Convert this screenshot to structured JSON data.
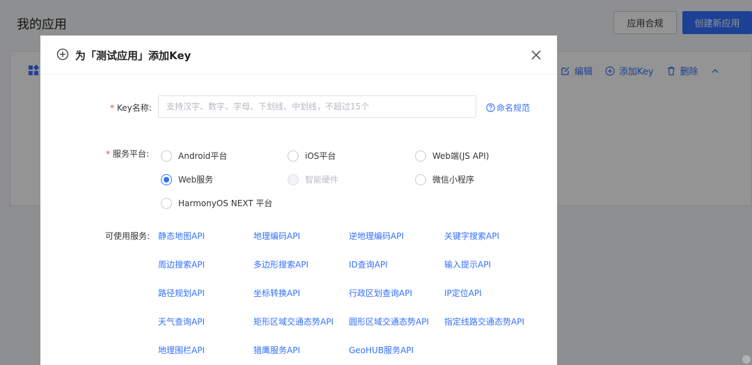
{
  "page": {
    "title": "我的应用",
    "compliance_button": "应用合规",
    "create_button": "创建新应用",
    "card_actions": {
      "edit": "编辑",
      "add_key": "添加Key",
      "delete": "删除"
    }
  },
  "modal": {
    "title": "为「测试应用」添加Key",
    "key_name": {
      "label": "Key名称:",
      "placeholder": "支持汉字、数字、字母、下划线、中划线，不超过15个",
      "value": "",
      "naming_rule_link": "命名规范"
    },
    "platform": {
      "label": "服务平台:",
      "selected": "Web服务",
      "options": [
        {
          "label": "Android平台",
          "state": "unchecked"
        },
        {
          "label": "iOS平台",
          "state": "unchecked"
        },
        {
          "label": "Web端(JS API)",
          "state": "unchecked"
        },
        {
          "label": "Web服务",
          "state": "checked"
        },
        {
          "label": "智能硬件",
          "state": "disabled"
        },
        {
          "label": "微信小程序",
          "state": "unchecked"
        },
        {
          "label": "HarmonyOS NEXT 平台",
          "state": "unchecked"
        }
      ]
    },
    "services": {
      "label": "可使用服务:",
      "items": [
        "静态地图API",
        "地理编码API",
        "逆地理编码API",
        "关键字搜索API",
        "周边搜索API",
        "多边形搜索API",
        "ID查询API",
        "输入提示API",
        "路径规划API",
        "坐标转换API",
        "行政区划查询API",
        "IP定位API",
        "天气查询API",
        "矩形区域交通态势API",
        "圆形区域交通态势API",
        "指定线路交通态势API",
        "地理围栏API",
        "猎鹰服务API",
        "GeoHUB服务API"
      ]
    }
  },
  "colors": {
    "primary": "#3370ff",
    "required": "#e84646"
  }
}
